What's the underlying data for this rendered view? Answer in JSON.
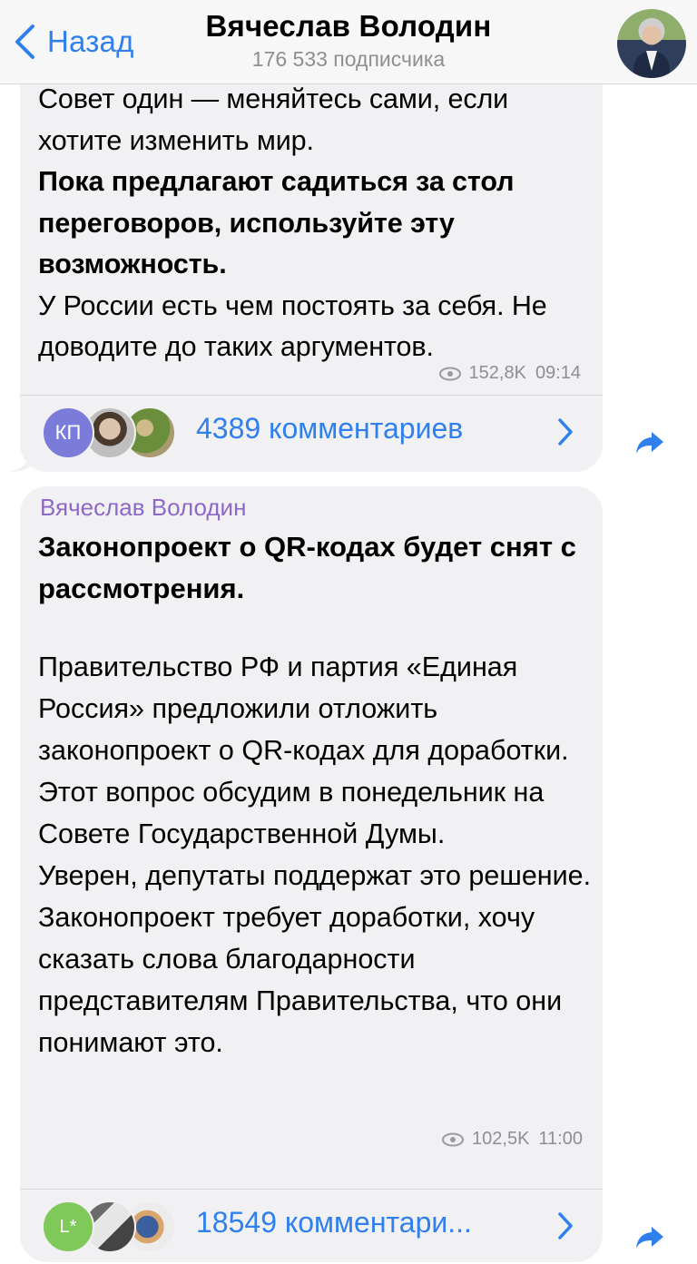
{
  "header": {
    "back_label": "Назад",
    "title": "Вячеслав Володин",
    "subtitle": "176 533 подписчика",
    "avatar_icon": "profile-photo"
  },
  "post1": {
    "lines": [
      "Совет один — меняйтесь сами, если хотите изменить мир."
    ],
    "bold": "Пока предлагают садиться за стол переговоров, используйте эту возможность.",
    "tail": "У России есть чем постоять за себя. Не доводите до таких аргументов.",
    "views": "152,8K",
    "time": "09:14",
    "avatar_label": "КП",
    "comments": "4389 комментариев"
  },
  "post2": {
    "sender": "Вячеслав Володин",
    "headline": "Законопроект о QR-кодах будет снят с рассмотрения.",
    "body": "Правительство РФ и партия «Единая Россия» предложили отложить законопроект о QR-кодах для доработки.\nЭтот вопрос обсудим в понедельник на Совете Государственной Думы.\nУверен, депутаты поддержат это решение.\nЗаконопроект требует доработки, хочу сказать слова благодарности представителям Правительства, что они понимают это.",
    "views": "102,5K",
    "time": "11:00",
    "avatar_label": "L*",
    "comments": "18549 комментари..."
  },
  "colors": {
    "accent": "#2f80ed",
    "sender": "#8e68c6",
    "bubble": "#f1f1f4",
    "meta": "#8e8e93"
  }
}
